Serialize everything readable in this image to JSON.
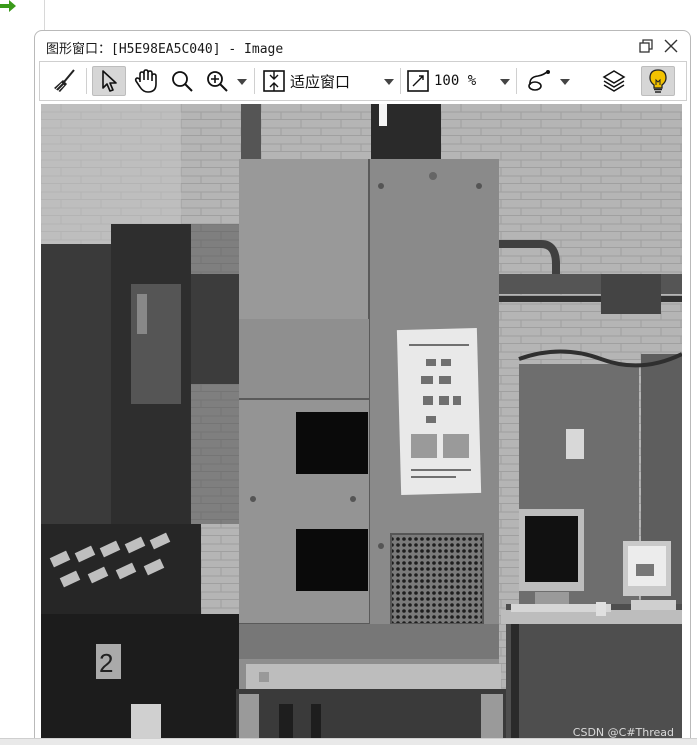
{
  "window": {
    "title": "图形窗口：[H5E98EA5C040] - Image",
    "restore_label": "restore",
    "close_label": "close"
  },
  "toolbar": {
    "clear_icon": "broom-icon",
    "pointer_icon": "arrow-pointer-icon",
    "pan_icon": "hand-icon",
    "magnify_icon": "magnifier-icon",
    "zoom_icon": "zoom-in-icon",
    "fit_label": "适应窗口",
    "zoom_label": "100 %",
    "shape_icon": "draw-shape-icon",
    "layers_icon": "layers-icon",
    "hint_icon": "lightbulb-icon"
  },
  "image": {
    "description_icon": "machine-photo",
    "watermark": "CSDN @C#Thread"
  },
  "colors": {
    "window_border": "#b9b9b9",
    "active_button": "#d6d6d6",
    "bulb": "#f2c200"
  }
}
